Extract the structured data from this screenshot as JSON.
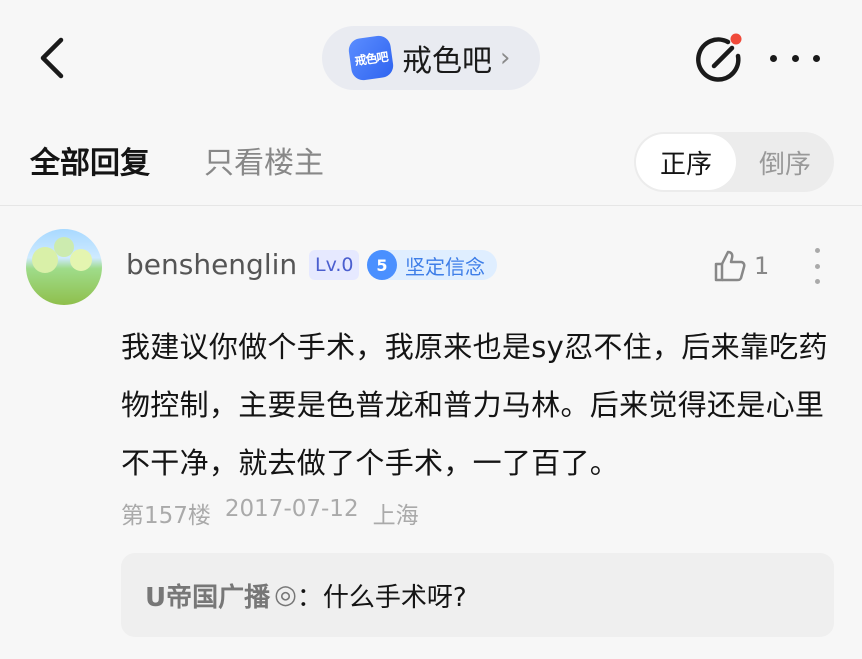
{
  "header": {
    "forum_logo_text": "戒色吧",
    "forum_name": "戒色吧",
    "forum_chevron": "›",
    "icons": [
      "back-icon",
      "edit-icon",
      "more-icon"
    ],
    "edit_dot_color": "#f04a3a"
  },
  "tabs": {
    "all_replies": "全部回复",
    "owner_only": "只看楼主",
    "sort_asc": "正序",
    "sort_desc": "倒序"
  },
  "post": {
    "username": "benshenglin",
    "level": "Lv.0",
    "title_level": "5",
    "title": "坚定信念",
    "likes": "1",
    "body": "我建议你做个手术，我原来也是sy忍不住，后来靠吃药物控制，主要是色普龙和普力马林。后来觉得还是心里不干净，就去做了个手术，一了百了。",
    "floor": "第157楼",
    "date": "2017-07-12",
    "location": "上海"
  },
  "reply": {
    "user": "U帝国广播",
    "mark": "◎",
    "text": "：什么手术呀?"
  }
}
